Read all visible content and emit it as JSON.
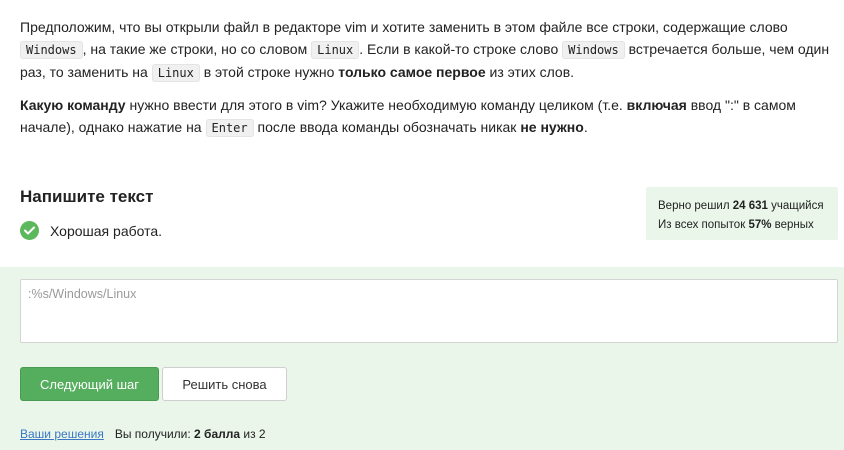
{
  "task": {
    "p1": [
      {
        "t": "text",
        "v": "Предположим, что вы открыли файл в редакторе vim и хотите заменить в этом файле все строки, содержащие слово "
      },
      {
        "t": "code",
        "v": "Windows"
      },
      {
        "t": "text",
        "v": ", на такие же строки, но со словом "
      },
      {
        "t": "code",
        "v": "Linux"
      },
      {
        "t": "text",
        "v": ". Если в какой-то строке слово "
      },
      {
        "t": "code",
        "v": "Windows"
      },
      {
        "t": "text",
        "v": " встречается больше, чем один раз, то заменить на "
      },
      {
        "t": "code",
        "v": "Linux"
      },
      {
        "t": "text",
        "v": " в этой строке нужно "
      },
      {
        "t": "bold",
        "v": "только самое первое"
      },
      {
        "t": "text",
        "v": " из этих слов."
      }
    ],
    "p2": [
      {
        "t": "bold",
        "v": "Какую команду"
      },
      {
        "t": "text",
        "v": " нужно ввести для этого в vim? Укажите необходимую команду целиком (т.е. "
      },
      {
        "t": "bold",
        "v": "включая"
      },
      {
        "t": "text",
        "v": " ввод \":\" в самом начале), однако нажатие на "
      },
      {
        "t": "code",
        "v": "Enter"
      },
      {
        "t": "text",
        "v": " после ввода команды обозначать никак "
      },
      {
        "t": "bold",
        "v": "не нужно"
      },
      {
        "t": "text",
        "v": "."
      }
    ]
  },
  "section": {
    "title": "Напишите текст",
    "feedback": "Хорошая работа.",
    "feedback_icon": "check-circle-icon"
  },
  "stats": {
    "solved_prefix": "Верно решил ",
    "solved_count": "24 631",
    "solved_suffix": " учащийся",
    "attempts_prefix": "Из всех попыток ",
    "attempts_percent": "57%",
    "attempts_suffix": " верных"
  },
  "answer": {
    "value": ":%s/Windows/Linux"
  },
  "buttons": {
    "next": "Следующий шаг",
    "retry": "Решить снова"
  },
  "footer": {
    "solutions_link": "Ваши решения",
    "score_prefix": "Вы получили: ",
    "score_bold": "2 балла",
    "score_suffix": " из 2"
  },
  "colors": {
    "accent_green": "#55ad5e",
    "success_bg": "#eaf6ea",
    "link": "#3b77c4"
  }
}
